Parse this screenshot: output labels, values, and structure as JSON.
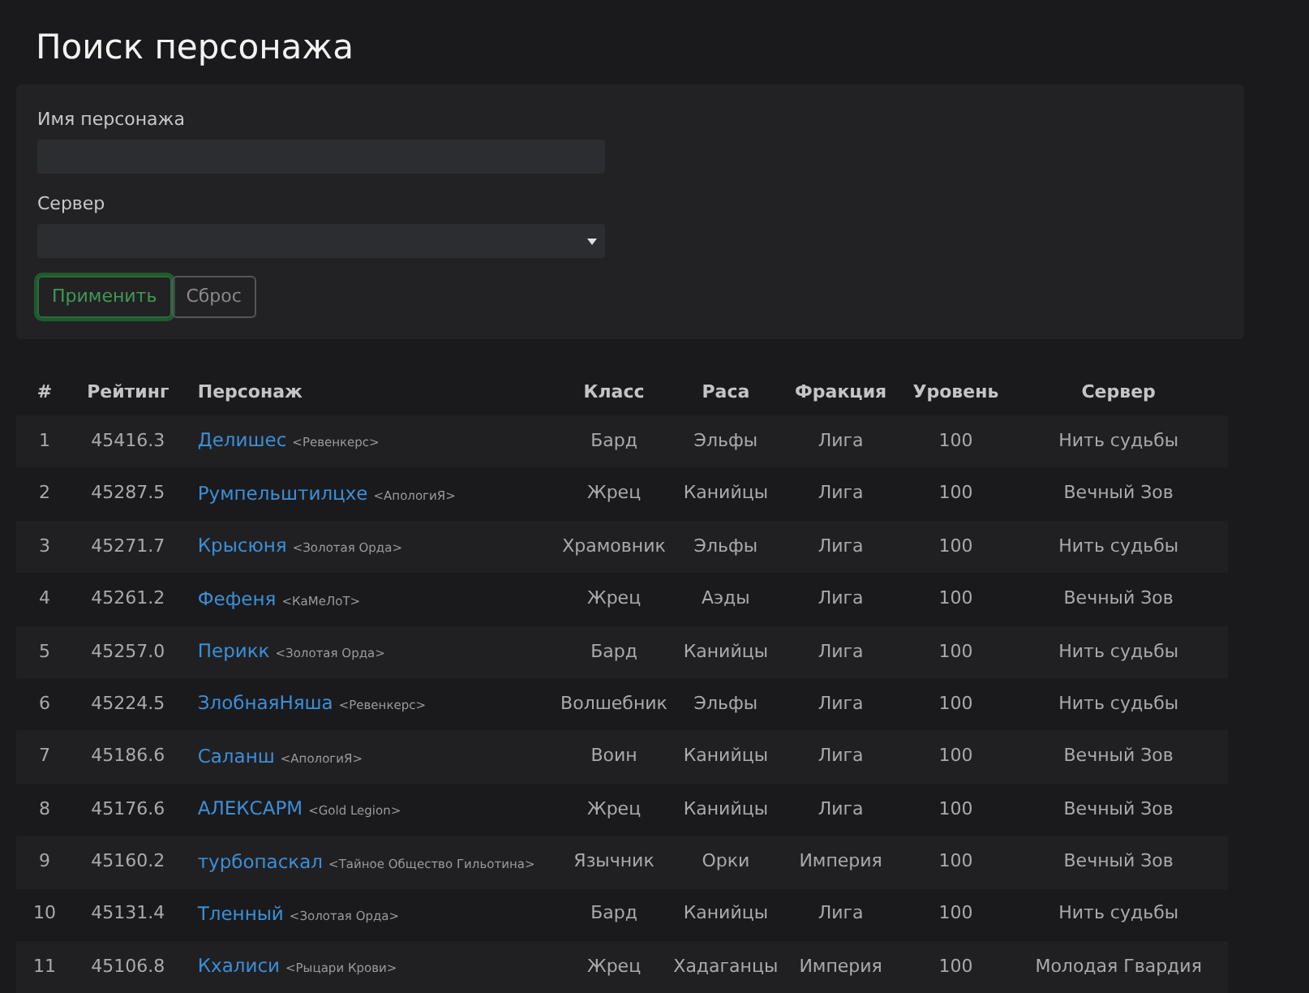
{
  "title": "Поиск персонажа",
  "form": {
    "name_label": "Имя персонажа",
    "server_label": "Сервер",
    "buttons": [
      {
        "label": "Применить",
        "kind": "primary",
        "focused": true
      },
      {
        "label": "Сброс",
        "kind": "secondary",
        "focused": false
      }
    ]
  },
  "table": {
    "columns": [
      "#",
      "Рейтинг",
      "Персонаж",
      "Класс",
      "Раса",
      "Фракция",
      "Уровень",
      "Сервер"
    ],
    "rows": [
      {
        "rank": "1",
        "rating": "45416.3",
        "name": "Делишес",
        "guild": "<Ревенкерс>",
        "class": "Бард",
        "race": "Эльфы",
        "faction": "Лига",
        "level_text": "100",
        "server": "Нить судьбы"
      },
      {
        "rank": "2",
        "rating": "45287.5",
        "name": "Румпельштилцхе",
        "guild": "<АпологиЯ>",
        "class": "Жрец",
        "race": "Канийцы",
        "faction": "Лига",
        "level_text": "100",
        "server": "Вечный Зов"
      },
      {
        "rank": "3",
        "rating": "45271.7",
        "name": "Крысюня",
        "guild": "<Золотая Орда>",
        "class": "Храмовник",
        "race": "Эльфы",
        "faction": "Лига",
        "level_text": "100",
        "server": "Нить судьбы"
      },
      {
        "rank": "4",
        "rating": "45261.2",
        "name": "Фефеня",
        "guild": "<КаМеЛоТ>",
        "class": "Жрец",
        "race": "Аэды",
        "faction": "Лига",
        "level_text": "100",
        "server": "Вечный Зов"
      },
      {
        "rank": "5",
        "rating": "45257.0",
        "name": "Перикк",
        "guild": "<Золотая Орда>",
        "class": "Бард",
        "race": "Канийцы",
        "faction": "Лига",
        "level_text": "100",
        "server": "Нить судьбы"
      },
      {
        "rank": "6",
        "rating": "45224.5",
        "name": "ЗлобнаяНяша",
        "guild": "<Ревенкерс>",
        "class": "Волшебник",
        "race": "Эльфы",
        "faction": "Лига",
        "level_text": "100",
        "server": "Нить судьбы"
      },
      {
        "rank": "7",
        "rating": "45186.6",
        "name": "Саланш",
        "guild": "<АпологиЯ>",
        "class": "Воин",
        "race": "Канийцы",
        "faction": "Лига",
        "level_text": "100",
        "server": "Вечный Зов"
      },
      {
        "rank": "8",
        "rating": "45176.6",
        "name": "АЛЕКСАРМ",
        "guild": "<Gold Legion>",
        "class": "Жрец",
        "race": "Канийцы",
        "faction": "Лига",
        "level_text": "100",
        "server": "Вечный Зов"
      },
      {
        "rank": "9",
        "rating": "45160.2",
        "name": "турбопаскал",
        "guild": "<Тайное Общество Гильотина>",
        "class": "Язычник",
        "race": "Орки",
        "faction": "Империя",
        "level_text": "100",
        "server": "Вечный Зов"
      },
      {
        "rank": "10",
        "rating": "45131.4",
        "name": "Тленный",
        "guild": "<Золотая Орда>",
        "class": "Бард",
        "race": "Канийцы",
        "faction": "Лига",
        "level_text": "100",
        "server": "Нить судьбы"
      },
      {
        "rank": "11",
        "rating": "45106.8",
        "name": "Кхалиси",
        "guild": "<Рыцари Крови>",
        "class": "Жрец",
        "race": "Хадаганцы",
        "faction": "Империя",
        "level_text": "100",
        "server": "Молодая Гвардия"
      }
    ]
  }
}
